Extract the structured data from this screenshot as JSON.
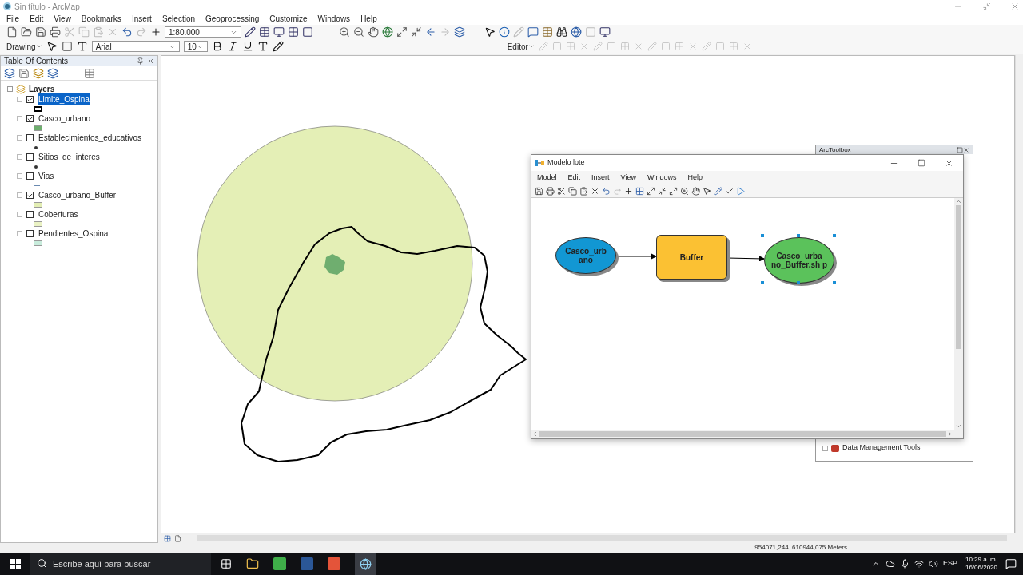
{
  "window": {
    "title": "Sin título - ArcMap"
  },
  "menu": [
    "File",
    "Edit",
    "View",
    "Bookmarks",
    "Insert",
    "Selection",
    "Geoprocessing",
    "Customize",
    "Windows",
    "Help"
  ],
  "standard_toolbar": {
    "scale": "1:80.000"
  },
  "drawing_toolbar": {
    "menu": "Drawing",
    "font": "Arial",
    "font_size": "10"
  },
  "editor_toolbar": {
    "menu": "Editor"
  },
  "toc": {
    "title": "Table Of Contents",
    "root": "Layers",
    "layers": [
      {
        "name": "Limite_Ospina",
        "checked": true,
        "selected": true,
        "kind": "outline"
      },
      {
        "name": "Casco_urbano",
        "checked": true,
        "selected": false,
        "kind": "fill",
        "color": "#6fae6f"
      },
      {
        "name": "Establecimientos_educativos",
        "checked": false,
        "selected": false,
        "kind": "point"
      },
      {
        "name": "Sitios_de_interes",
        "checked": false,
        "selected": false,
        "kind": "point"
      },
      {
        "name": "Vias",
        "checked": false,
        "selected": false,
        "kind": "line"
      },
      {
        "name": "Casco_urbano_Buffer",
        "checked": true,
        "selected": false,
        "kind": "fill",
        "color": "#e3eeb4"
      },
      {
        "name": "Coberturas",
        "checked": false,
        "selected": false,
        "kind": "fill",
        "color": "#eaf2c4"
      },
      {
        "name": "Pendientes_Ospina",
        "checked": false,
        "selected": false,
        "kind": "fill",
        "color": "#c8ecdc"
      }
    ]
  },
  "arctoolbox": {
    "title": "ArcToolbox",
    "items": [
      "Data Management Tools"
    ]
  },
  "model_window": {
    "title": "Modelo lote",
    "menu": [
      "Model",
      "Edit",
      "Insert",
      "View",
      "Windows",
      "Help"
    ],
    "nodes": [
      {
        "kind": "data",
        "label": "Casco_urb ano",
        "selected": false
      },
      {
        "kind": "tool",
        "label": "Buffer",
        "selected": false
      },
      {
        "kind": "output",
        "label": "Casco_urba no_Buffer.sh p",
        "selected": true
      }
    ]
  },
  "status_bar": {
    "coordinates": "954071,244  610944,075 Meters"
  },
  "taskbar": {
    "search_placeholder": "Escribe aquí para buscar",
    "language": "ESP",
    "time": "10:29 a. m.",
    "date": "16/06/2020"
  }
}
